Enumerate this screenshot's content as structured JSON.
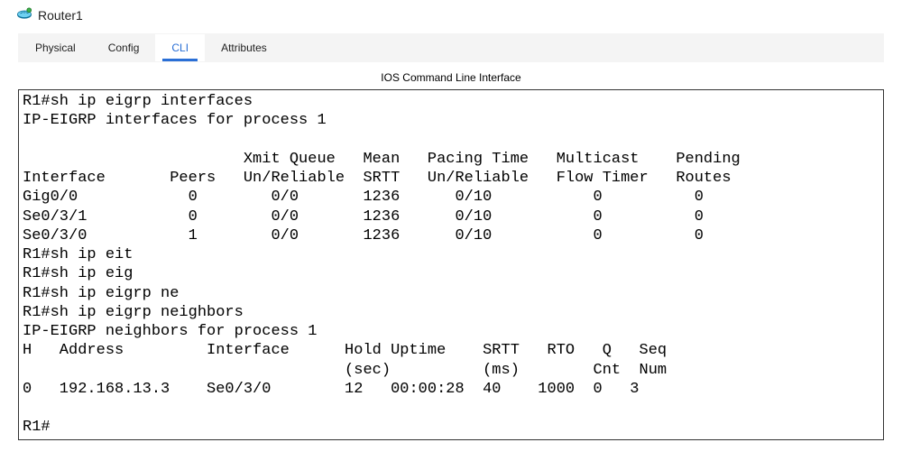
{
  "window": {
    "title": "Router1"
  },
  "tabs": {
    "physical": "Physical",
    "config": "Config",
    "cli": "CLI",
    "attributes": "Attributes",
    "active": "cli"
  },
  "cli": {
    "caption": "IOS Command Line Interface"
  },
  "chart_data": {
    "type": "table",
    "prompt": "R1#",
    "commands": [
      "sh ip eigrp interfaces",
      "sh ip eit",
      "sh ip eig",
      "sh ip eigrp ne",
      "sh ip eigrp neighbors"
    ],
    "interfaces_header": "IP-EIGRP interfaces for process 1",
    "interfaces_columns": [
      "Interface",
      "Peers",
      "Xmit Queue Un/Reliable",
      "Mean SRTT",
      "Pacing Time Un/Reliable",
      "Multicast Flow Timer",
      "Pending Routes"
    ],
    "interfaces_rows": [
      {
        "Interface": "Gig0/0",
        "Peers": 0,
        "XmitQueue": "0/0",
        "MeanSRTT": 1236,
        "Pacing": "0/10",
        "Multicast": 0,
        "Pending": 0
      },
      {
        "Interface": "Se0/3/1",
        "Peers": 0,
        "XmitQueue": "0/0",
        "MeanSRTT": 1236,
        "Pacing": "0/10",
        "Multicast": 0,
        "Pending": 0
      },
      {
        "Interface": "Se0/3/0",
        "Peers": 1,
        "XmitQueue": "0/0",
        "MeanSRTT": 1236,
        "Pacing": "0/10",
        "Multicast": 0,
        "Pending": 0
      }
    ],
    "neighbors_header": "IP-EIGRP neighbors for process 1",
    "neighbors_columns": [
      "H",
      "Address",
      "Interface",
      "Hold (sec)",
      "Uptime",
      "SRTT (ms)",
      "RTO",
      "Q Cnt",
      "Seq Num"
    ],
    "neighbors_rows": [
      {
        "H": 0,
        "Address": "192.168.13.3",
        "Interface": "Se0/3/0",
        "Hold": 12,
        "Uptime": "00:00:28",
        "SRTT": 40,
        "RTO": 1000,
        "QCnt": 0,
        "SeqNum": 3
      }
    ]
  },
  "cli_text": "R1#sh ip eigrp interfaces\nIP-EIGRP interfaces for process 1\n\n                        Xmit Queue   Mean   Pacing Time   Multicast    Pending\nInterface       Peers   Un/Reliable  SRTT   Un/Reliable   Flow Timer   Routes\nGig0/0            0        0/0       1236      0/10           0          0\nSe0/3/1           0        0/0       1236      0/10           0          0\nSe0/3/0           1        0/0       1236      0/10           0          0\nR1#sh ip eit\nR1#sh ip eig\nR1#sh ip eigrp ne\nR1#sh ip eigrp neighbors\nIP-EIGRP neighbors for process 1\nH   Address         Interface      Hold Uptime    SRTT   RTO   Q   Seq\n                                   (sec)          (ms)        Cnt  Num\n0   192.168.13.3    Se0/3/0        12   00:00:28  40    1000  0   3\n\nR1#"
}
